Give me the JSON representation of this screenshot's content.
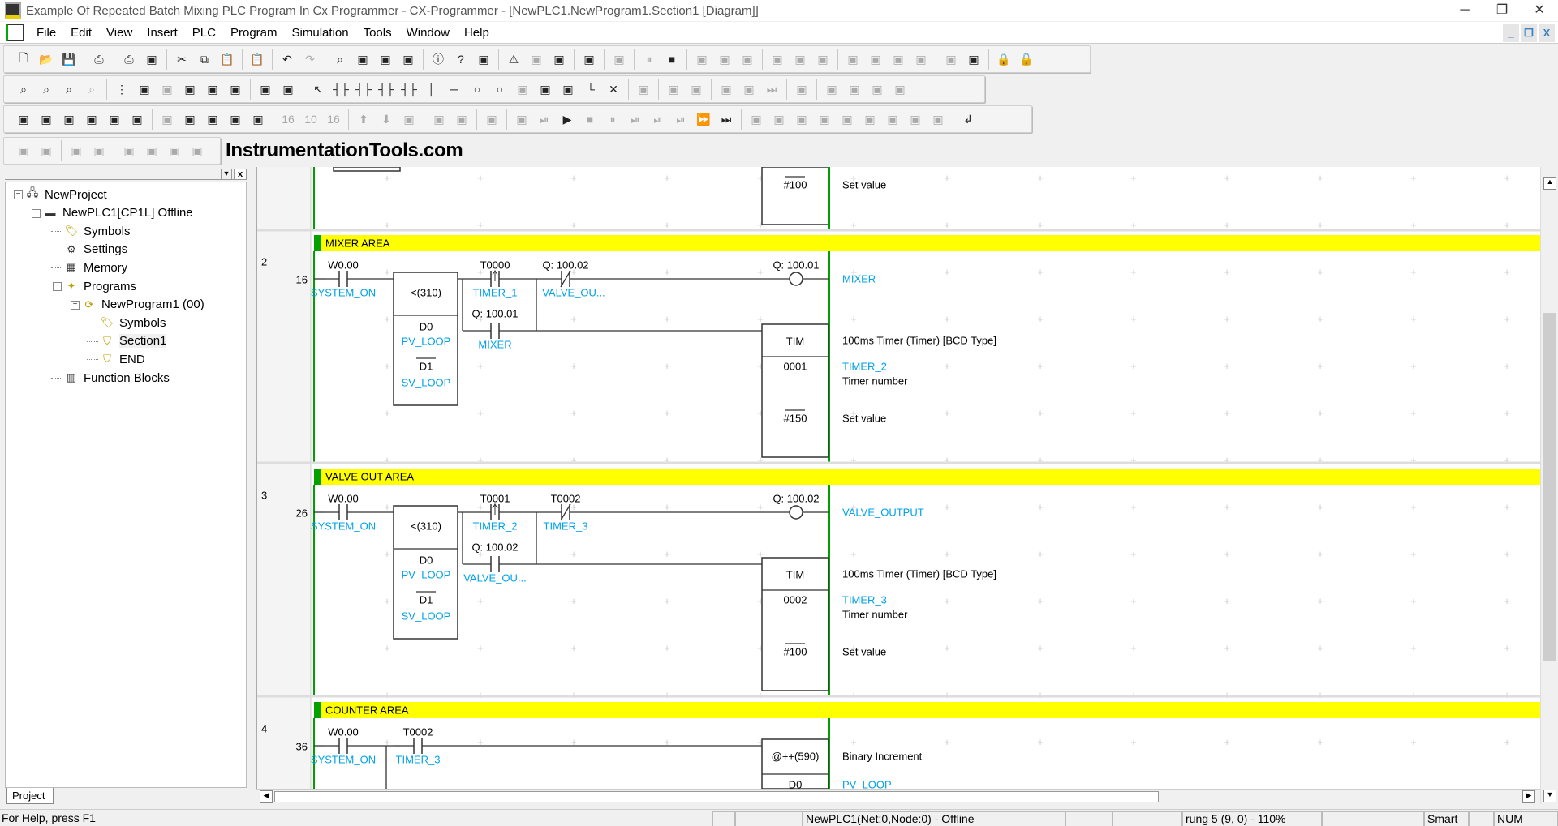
{
  "window": {
    "title": "Example Of Repeated Batch Mixing PLC Program In Cx Programmer - CX-Programmer - [NewPLC1.NewProgram1.Section1 [Diagram]]",
    "controls": [
      "minimize",
      "restore",
      "close"
    ]
  },
  "menu": [
    "File",
    "Edit",
    "View",
    "Insert",
    "PLC",
    "Program",
    "Simulation",
    "Tools",
    "Window",
    "Help"
  ],
  "toolbars": [
    [
      "new-icon",
      "open-icon",
      "save-icon",
      "|",
      "print-preview-icon",
      "|",
      "print-icon",
      "preview-icon",
      "|",
      "cut-icon",
      "copy-icon",
      "paste-icon",
      "|",
      "paste-special-icon",
      "|",
      "undo-icon",
      "redo-icon",
      "|",
      "find-icon",
      "replace-icon",
      "cross-ref-icon",
      "address-ref-icon",
      "|",
      "info-icon",
      "help-icon",
      "context-help-icon",
      "||",
      "warning-icon",
      "online-icon",
      "monitor-icon",
      "|",
      "compile-icon",
      "|",
      "program-check-icon",
      "|",
      "pause-icon",
      "stop-icon",
      "|",
      "transfer-icon",
      "upload-icon",
      "compare-icon",
      "|",
      "force-on-icon",
      "force-off-icon",
      "cancel-force-icon",
      "|",
      "set-icon",
      "reset-icon",
      "set-value-icon",
      "change-icon",
      "|",
      "diff-icon",
      "timechart-icon",
      "|",
      "lock-icon",
      "unlock-icon"
    ],
    [
      "zoom-small-icon",
      "zoom-fit-icon",
      "zoom-in-icon",
      "zoom-out-icon",
      "|",
      "grid-icon",
      "comment-icon",
      "rung-list-icon",
      "ladder-icon",
      "symbol-table-icon",
      "tree-icon",
      "|",
      "sma-icon",
      "ci-icon",
      "|",
      "select-icon",
      "contact-no-icon",
      "contact-nc-icon",
      "or-no-icon",
      "or-nc-icon",
      "vertical-icon",
      "horizontal-icon",
      "coil-icon",
      "coil-nc-icon",
      "instruction-icon",
      "fb-icon",
      "pt-icon",
      "line-icon",
      "delete-line-icon",
      "||",
      "online-edit-icon",
      "|",
      "transfer-edit-icon",
      "download-icon",
      "|",
      "cancel-edit-icon",
      "begin-edit-icon",
      "end-edit-icon",
      "|",
      "io-table-icon",
      "|",
      "memory-card-icon",
      "check-icon",
      "verify-icon",
      "verify2-icon"
    ],
    [
      "workspace-icon",
      "build-icon",
      "watch-icon",
      "output-icon",
      "window-icon",
      "properties-icon",
      "|",
      "section-icon",
      "symbols-icon",
      "diagram-icon",
      "mnemonic-icon",
      "memory-view-icon",
      "|",
      "hex-10-icon",
      "dec-10-icon",
      "hex-16-icon",
      "|",
      "up-icon",
      "down-icon",
      "monitor-diff-icon",
      "||",
      "sim-icon",
      "sim-debug-icon",
      "|",
      "task-icon",
      "|",
      "hand-icon",
      "step-icon",
      "run-icon",
      "stop-sim-icon",
      "pause-sim-icon",
      "step-in-icon",
      "step-over-icon",
      "step-out-icon",
      "fast-icon",
      "end-icon",
      "||",
      "break-icon",
      "break2-icon",
      "break3-icon",
      "break4-icon",
      "trigger-icon",
      "trigger2-icon",
      "trigger3-icon",
      "trigger4-icon",
      "trigger5-icon",
      "|",
      "return-icon"
    ],
    [
      "indent-icon",
      "outdent-icon",
      "|",
      "list-icon",
      "list2-icon",
      "|",
      "trace-icon",
      "trace2-icon",
      "trace3-icon",
      "trace4-icon"
    ]
  ],
  "brand": "InstrumentationTools.com",
  "tree": [
    {
      "label": "NewProject",
      "icon": "project-icon",
      "level": 0,
      "expand": "-"
    },
    {
      "label": "NewPLC1[CP1L] Offline",
      "icon": "plc-icon",
      "level": 1,
      "expand": "-"
    },
    {
      "label": "Symbols",
      "icon": "symbols-icon",
      "level": 2
    },
    {
      "label": "Settings",
      "icon": "settings-icon",
      "level": 2
    },
    {
      "label": "Memory",
      "icon": "memory-icon",
      "level": 2
    },
    {
      "label": "Programs",
      "icon": "programs-icon",
      "level": 2,
      "expand": "-"
    },
    {
      "label": "NewProgram1 (00)",
      "icon": "program-icon",
      "level": 3,
      "expand": "-"
    },
    {
      "label": "Symbols",
      "icon": "symbols-icon",
      "level": 4
    },
    {
      "label": "Section1",
      "icon": "section-icon",
      "level": 4,
      "selected": true
    },
    {
      "label": "END",
      "icon": "section-icon",
      "level": 4
    },
    {
      "label": "Function Blocks",
      "icon": "function-blocks-icon",
      "level": 2
    }
  ],
  "project_tab": "Project",
  "colors": {
    "comment_bar": "#ffff00",
    "bus": "#00a000",
    "symbol": "#00a2e8"
  },
  "diagram": {
    "prev_rung": {
      "sv": "#100",
      "sv_desc": "Set value"
    },
    "rungs": [
      {
        "number": "2",
        "step": "16",
        "comment": "MIXER AREA",
        "input": {
          "addr": "W0.00",
          "sym": "SYSTEM_ON"
        },
        "compare": {
          "op": "<(310)",
          "a": "D0",
          "a_sym": "PV_LOOP",
          "b": "D1",
          "b_sym": "SV_LOOP"
        },
        "contact_up": {
          "addr": "T0000",
          "sym": "TIMER_1"
        },
        "contact_nc": {
          "addr": "Q: 100.02",
          "sym": "VALVE_OU..."
        },
        "seal": {
          "addr": "Q: 100.01",
          "sym": "MIXER"
        },
        "coil": {
          "addr": "Q: 100.01",
          "sym": "MIXER"
        },
        "timer": {
          "name": "TIM",
          "desc": "100ms Timer (Timer) [BCD Type]",
          "num": "0001",
          "num_sym": "TIMER_2",
          "num_desc": "Timer number",
          "sv": "#150",
          "sv_desc": "Set value"
        }
      },
      {
        "number": "3",
        "step": "26",
        "comment": "VALVE OUT AREA",
        "input": {
          "addr": "W0.00",
          "sym": "SYSTEM_ON"
        },
        "compare": {
          "op": "<(310)",
          "a": "D0",
          "a_sym": "PV_LOOP",
          "b": "D1",
          "b_sym": "SV_LOOP"
        },
        "contact_up": {
          "addr": "T0001",
          "sym": "TIMER_2"
        },
        "contact_nc": {
          "addr": "T0002",
          "sym": "TIMER_3"
        },
        "seal": {
          "addr": "Q: 100.02",
          "sym": "VALVE_OU..."
        },
        "coil": {
          "addr": "Q: 100.02",
          "sym": "VALVE_OUTPUT"
        },
        "timer": {
          "name": "TIM",
          "desc": "100ms Timer (Timer) [BCD Type]",
          "num": "0002",
          "num_sym": "TIMER_3",
          "num_desc": "Timer number",
          "sv": "#100",
          "sv_desc": "Set value"
        }
      },
      {
        "number": "4",
        "step": "36",
        "comment": "COUNTER AREA",
        "input": {
          "addr": "W0.00",
          "sym": "SYSTEM_ON"
        },
        "contact": {
          "addr": "T0002",
          "sym": "TIMER_3"
        },
        "instr": {
          "name": "@++(590)",
          "desc": "Binary Increment",
          "op": "D0",
          "op_sym": "PV_LOOP"
        }
      }
    ]
  },
  "status": {
    "help": "For Help, press F1",
    "connection": "NewPLC1(Net:0,Node:0) - Offline",
    "position": "rung 5 (9, 0)  - 110%",
    "mode": "Smart",
    "num": "NUM"
  }
}
